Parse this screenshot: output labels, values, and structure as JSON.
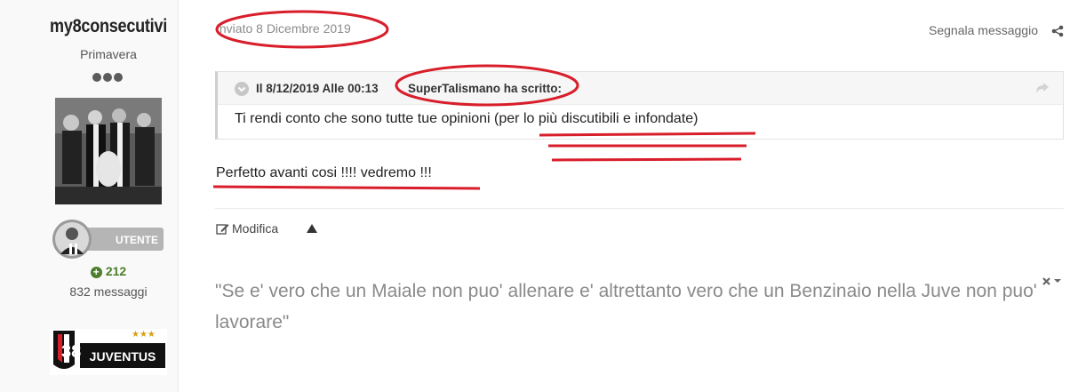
{
  "author": {
    "name": "my8consecutivi",
    "rank": "Primavera",
    "group_label": "UTENTE",
    "reputation": "212",
    "post_count": "832 messaggi",
    "club_logo_text": "JUVENTUS",
    "club_logo_number": "38"
  },
  "post": {
    "date": "Inviato 8 Dicembre 2019",
    "report_label": "Segnala messaggio",
    "quote": {
      "date": "Il 8/12/2019 Alle 00:13",
      "author": "SuperTalismano ha scritto:",
      "body": "Ti rendi conto che sono tutte tue opinioni (per lo più discutibili e infondate)"
    },
    "text": "Perfetto avanti cosi !!!! vedremo !!!",
    "edit_label": "Modifica",
    "signature": "\"Se e' vero che un Maiale non puo' allenare e' altrettanto vero che un Benzinaio nella Juve non puo' lavorare\""
  },
  "icons": {
    "share": "share-icon",
    "quote_toggle": "chevron-down-icon",
    "quote_goto": "reply-arrow-icon",
    "edit": "edit-icon",
    "caret": "caret-up-icon",
    "signature_controls": "close-dropdown-icon"
  },
  "colors": {
    "annotation_red": "#d81e2a",
    "reputation_green": "#4d7d2b",
    "muted_text": "#8a8a8a"
  }
}
